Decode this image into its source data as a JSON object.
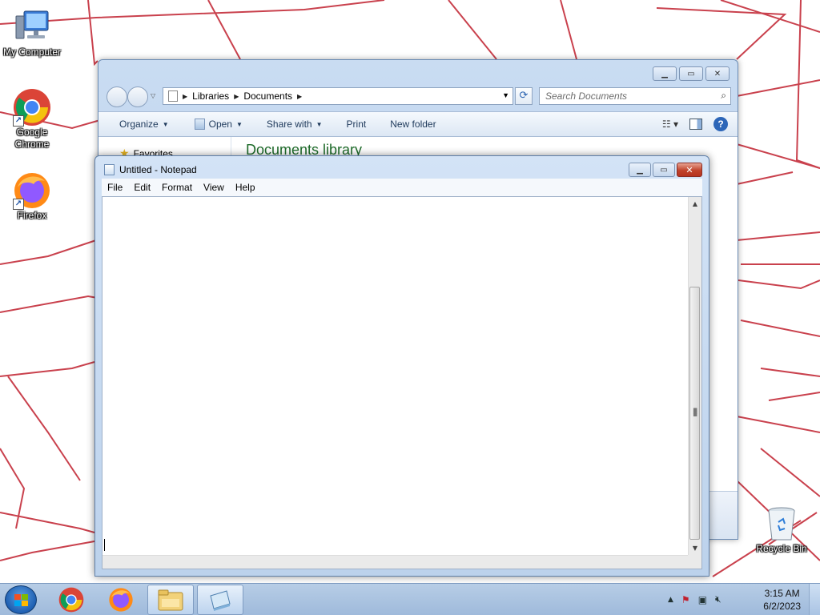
{
  "desktop": {
    "icons": [
      {
        "label": "My Computer"
      },
      {
        "label": "Google Chrome"
      },
      {
        "label": "Firefox"
      },
      {
        "label": "Recycle Bin"
      }
    ]
  },
  "explorer": {
    "breadcrumb": [
      "Libraries",
      "Documents"
    ],
    "search_placeholder": "Search Documents",
    "toolbar": {
      "organize": "Organize",
      "open": "Open",
      "share_with": "Share with",
      "print": "Print",
      "new_folder": "New folder"
    },
    "nav_favorites": "Favorites",
    "library_title": "Documents library"
  },
  "notepad": {
    "title": "Untitled - Notepad",
    "menu": [
      "File",
      "Edit",
      "Format",
      "View",
      "Help"
    ],
    "content": ""
  },
  "taskbar": {
    "time": "3:15 AM",
    "date": "6/2/2023"
  },
  "colors": {
    "wallpaper_lines": "#c0202e",
    "library_title": "#1e6b2a",
    "close_button": "#c1432c"
  }
}
